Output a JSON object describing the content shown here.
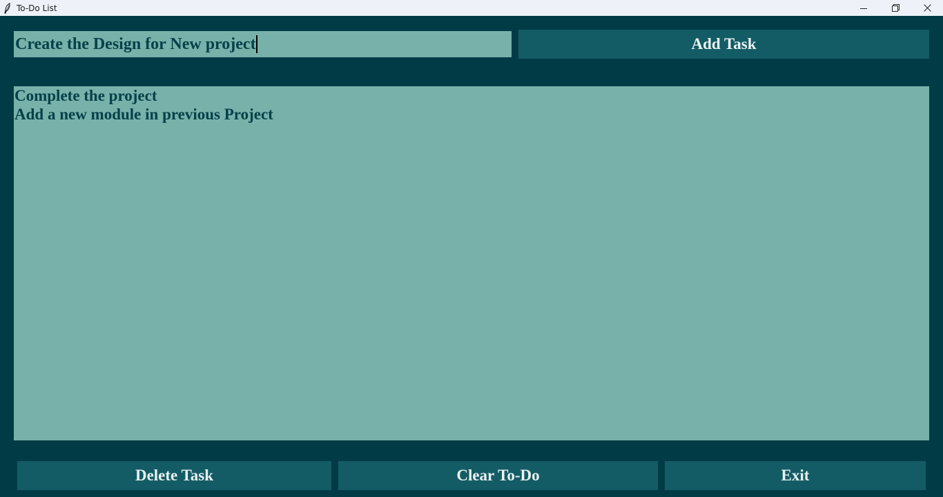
{
  "window": {
    "title": "To-Do List",
    "app_icon": "feather-icon",
    "controls": [
      "minimize-icon",
      "restore-icon",
      "close-icon"
    ]
  },
  "input": {
    "value": "Create the Design for New project"
  },
  "buttons": {
    "add_label": "Add Task",
    "delete_label": "Delete Task",
    "clear_label": "Clear To-Do",
    "exit_label": "Exit"
  },
  "tasks": [
    "Complete the project",
    "Add a new module in previous Project"
  ],
  "colors": {
    "background": "#013b46",
    "field": "#78b1a9",
    "button": "#145c65",
    "button_text": "#e9f2f2",
    "field_text": "#06404a"
  }
}
